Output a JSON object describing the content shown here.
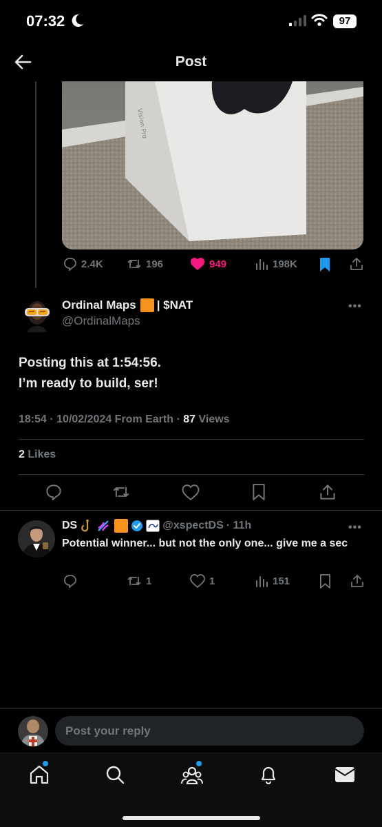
{
  "status_bar": {
    "time": "07:32",
    "battery": "97"
  },
  "header": {
    "title": "Post"
  },
  "parent_post": {
    "actions": {
      "replies": "2.4K",
      "reposts": "196",
      "likes": "949",
      "views": "198K"
    },
    "photo_box_text": "Vision Pro"
  },
  "main_post": {
    "author_name": "Ordinal Maps",
    "author_suffix": "| $NAT",
    "handle": "@OrdinalMaps",
    "text_line1": "Posting this at 1:54:56.",
    "text_line2": "I’m ready to build, ser!",
    "timestamp": "18:54 · 10/02/2024 From Earth ·",
    "views_count": "87",
    "views_label": "Views",
    "likes_count": "2",
    "likes_label": "Likes"
  },
  "reply": {
    "name": "DS",
    "handle": "@xspectDS",
    "time": "· 11h",
    "text": "Potential winner... but not the only one... give me a sec",
    "actions": {
      "reposts": "1",
      "likes": "1",
      "views": "151"
    }
  },
  "composer": {
    "placeholder": "Post your reply"
  },
  "colors": {
    "accent": "#1d9bf0",
    "like": "#f91880",
    "muted": "#71767b",
    "bitcoin": "#f7931a"
  },
  "icons": [
    "moon-icon",
    "signal-icon",
    "wifi-icon",
    "back-arrow-icon",
    "reply-icon",
    "repost-icon",
    "heart-icon",
    "views-icon",
    "bookmark-icon",
    "share-icon",
    "verified-icon",
    "home-icon",
    "search-icon",
    "communities-icon",
    "bell-icon",
    "mail-icon"
  ]
}
